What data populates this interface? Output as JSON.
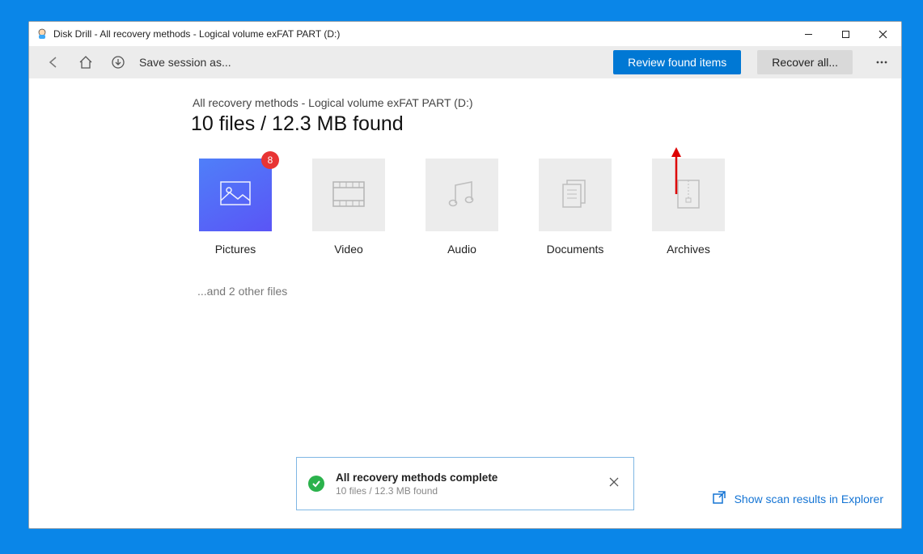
{
  "window": {
    "title": "Disk Drill - All recovery methods - Logical volume exFAT PART (D:)"
  },
  "toolbar": {
    "save_session_label": "Save session as...",
    "review_button": "Review found items",
    "recover_button": "Recover all..."
  },
  "main": {
    "breadcrumb": "All recovery methods - Logical volume exFAT PART (D:)",
    "headline": "10 files / 12.3 MB found",
    "other_files": "...and 2 other files"
  },
  "categories": [
    {
      "label": "Pictures",
      "badge": "8",
      "active": true
    },
    {
      "label": "Video"
    },
    {
      "label": "Audio"
    },
    {
      "label": "Documents"
    },
    {
      "label": "Archives"
    }
  ],
  "toast": {
    "title": "All recovery methods complete",
    "subtitle": "10 files / 12.3 MB found"
  },
  "footer": {
    "explorer_link": "Show scan results in Explorer"
  }
}
